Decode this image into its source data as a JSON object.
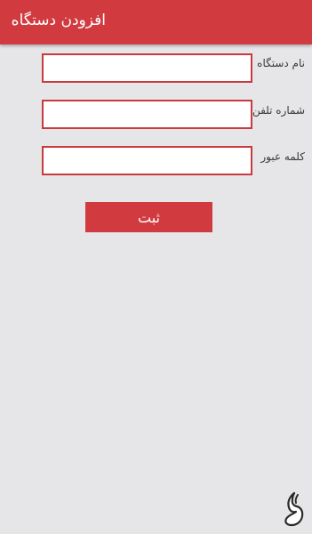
{
  "header": {
    "title": "افزودن دستگاه"
  },
  "form": {
    "device_name_label": "نام دستگاه",
    "device_name_value": "",
    "phone_label": "شماره تلفن",
    "phone_value": "",
    "password_label": "کلمه عبور",
    "password_value": "",
    "submit_label": "ثبت"
  },
  "colors": {
    "accent": "#d13b40",
    "background": "#e6e6e8",
    "input_border": "#c9393d"
  },
  "watermark": {
    "icon": "store-logo-icon"
  }
}
